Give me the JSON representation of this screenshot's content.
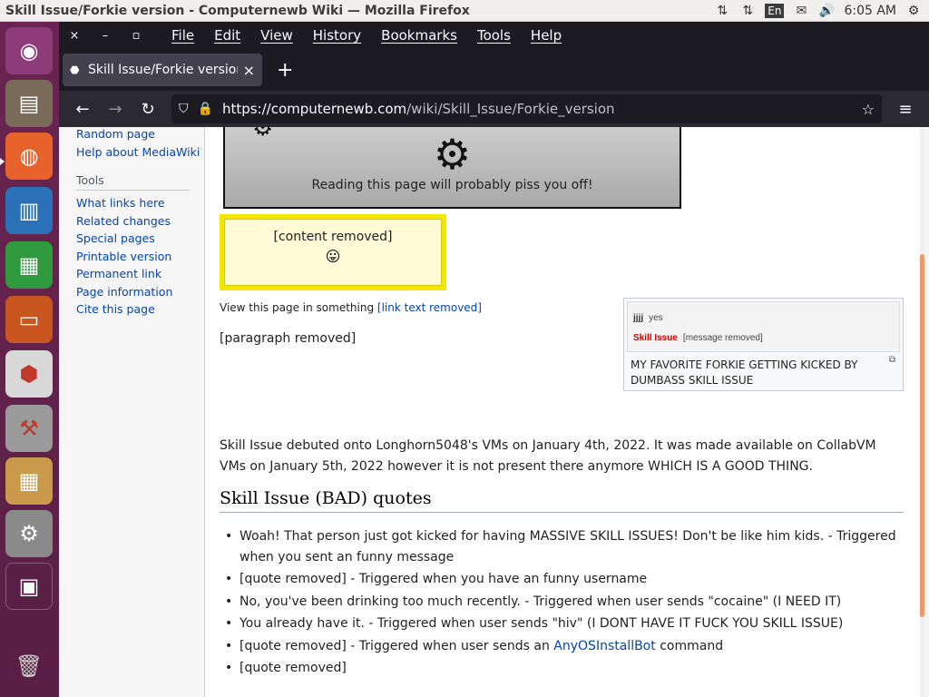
{
  "system": {
    "window_title": "Skill Issue/Forkie version - Computernewb Wiki — Mozilla Firefox",
    "keyboard_layout": "En",
    "clock": "6:05 AM"
  },
  "launcher": {
    "apps": [
      "ubuntu-icon",
      "files-icon",
      "firefox-icon",
      "writer-icon",
      "calc-icon",
      "impress-icon",
      "software-icon",
      "settings-tools-icon",
      "calculator-icon",
      "settings-icon",
      "workspace-icon",
      "trash-icon"
    ]
  },
  "firefox": {
    "menu": [
      "File",
      "Edit",
      "View",
      "History",
      "Bookmarks",
      "Tools",
      "Help"
    ],
    "tab_title": "Skill Issue/Forkie version",
    "url_host": "https://computernewb.com",
    "url_path": "/wiki/Skill_Issue/Forkie_version"
  },
  "sidebar": {
    "top_links": [
      "Random page",
      "Help about MediaWiki"
    ],
    "tools_heading": "Tools",
    "tools_links": [
      "What links here",
      "Related changes",
      "Special pages",
      "Printable version",
      "Permanent link",
      "Page information",
      "Cite this page"
    ]
  },
  "content": {
    "banner_text": "Reading this page will probably piss you off!",
    "yellowbox_text": "[content removed]",
    "yellowbox_emoji": "😛",
    "view_prefix": "View this page in something ",
    "view_link": "[link text removed]",
    "thumb": {
      "user": "jjjj",
      "user_msg": "yes",
      "bot": "Skill Issue",
      "bot_msg": "[message removed]",
      "caption": "MY FAVORITE FORKIE GETTING KICKED BY DUMBASS SKILL ISSUE"
    },
    "para1": "[paragraph removed]",
    "para2": "Skill Issue debuted onto Longhorn5048's VMs on January 4th, 2022. It was made available on CollabVM VMs on January 5th, 2022 however it is not present there anymore WHICH IS A GOOD THING.",
    "quotes_heading": "Skill Issue (BAD) quotes",
    "quotes": [
      {
        "text": "Woah! That person just got kicked for having MASSIVE SKILL ISSUES! Don't be like him kids. - Triggered when you sent an funny message"
      },
      {
        "text": "[quote removed] - Triggered when you have an funny username"
      },
      {
        "text": "No, you've been drinking too much recently. - Triggered when user sends \"cocaine\" (I NEED IT)"
      },
      {
        "text": "You already have it. - Triggered when user sends \"hiv\" (I DONT HAVE IT FUCK YOU SKILL ISSUE)"
      },
      {
        "text_before": "[quote removed] - Triggered when user sends an ",
        "link": "AnyOSInstallBot",
        "text_after": " command"
      },
      {
        "text": "[quote removed]"
      }
    ]
  }
}
